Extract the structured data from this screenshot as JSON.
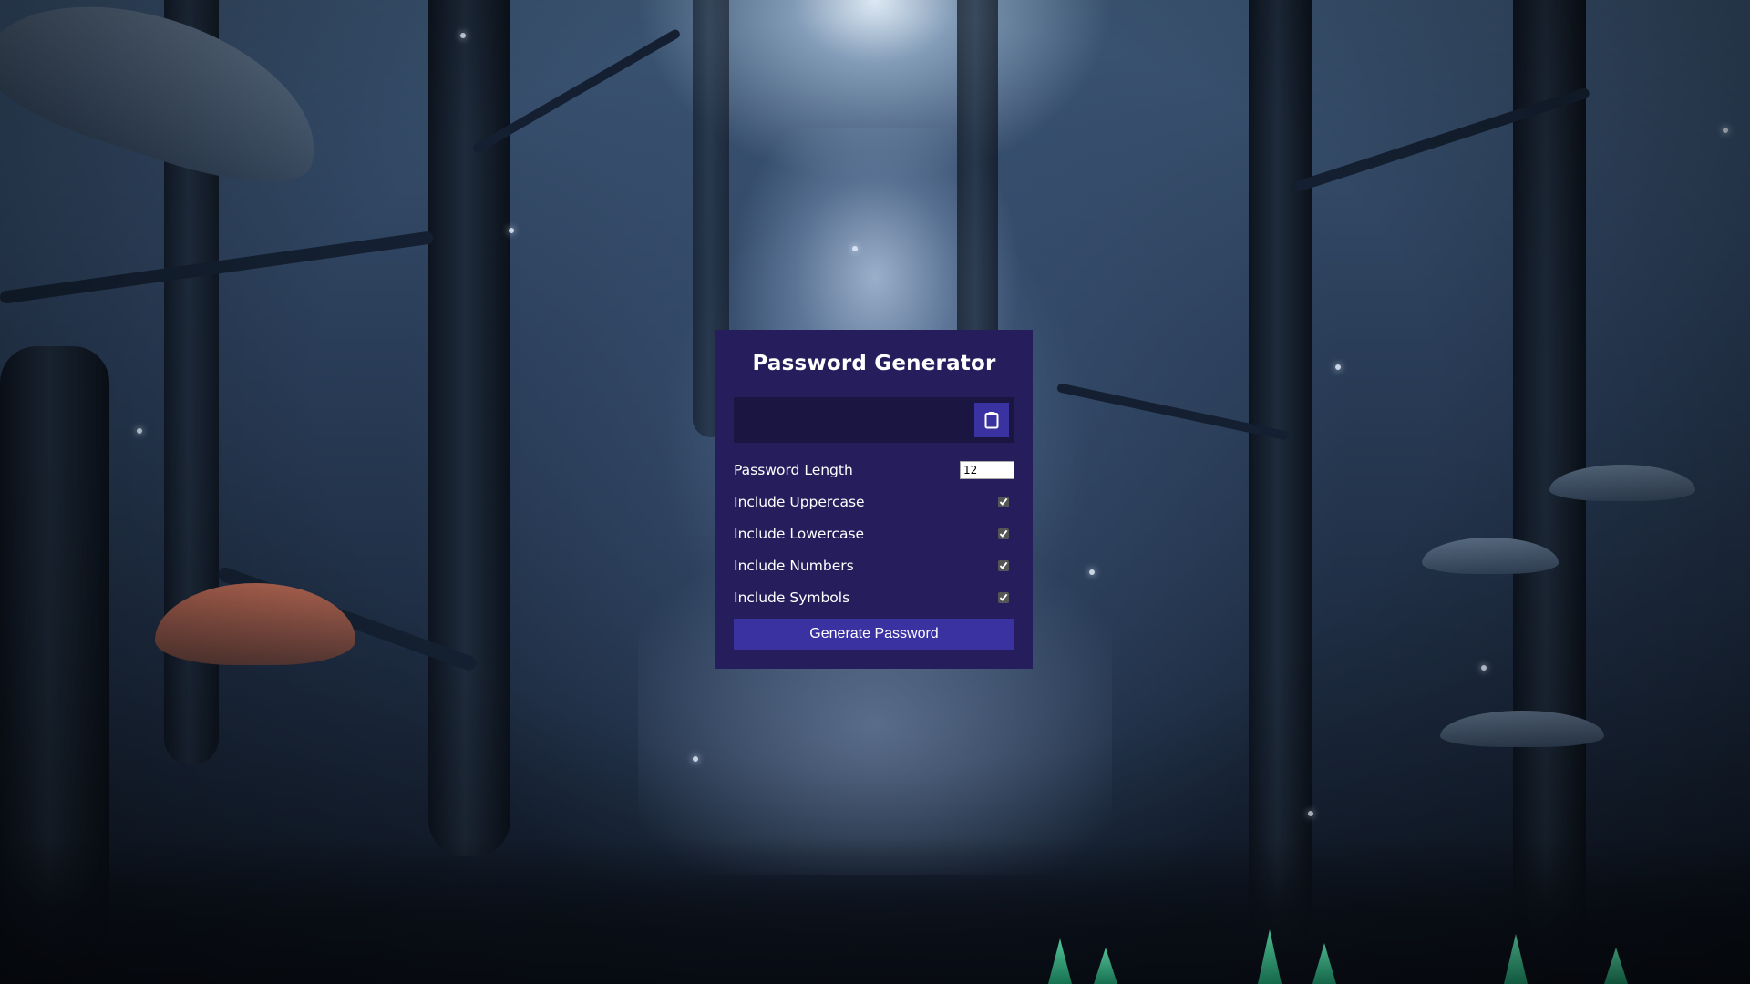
{
  "app": {
    "title": "Password Generator"
  },
  "result": {
    "value": "",
    "clipboard_icon": "clipboard-icon"
  },
  "settings": {
    "length": {
      "label": "Password Length",
      "value": "12"
    },
    "uppercase": {
      "label": "Include Uppercase",
      "checked": true
    },
    "lowercase": {
      "label": "Include Lowercase",
      "checked": true
    },
    "numbers": {
      "label": "Include Numbers",
      "checked": true
    },
    "symbols": {
      "label": "Include Symbols",
      "checked": true
    }
  },
  "actions": {
    "generate_label": "Generate Password"
  },
  "theme": {
    "card_bg": "#251d5c",
    "result_bg": "#1b1542",
    "accent": "#3b32a2",
    "text": "#ffffff"
  },
  "background": {
    "description_icon": "enchanted-forest-wallpaper"
  }
}
